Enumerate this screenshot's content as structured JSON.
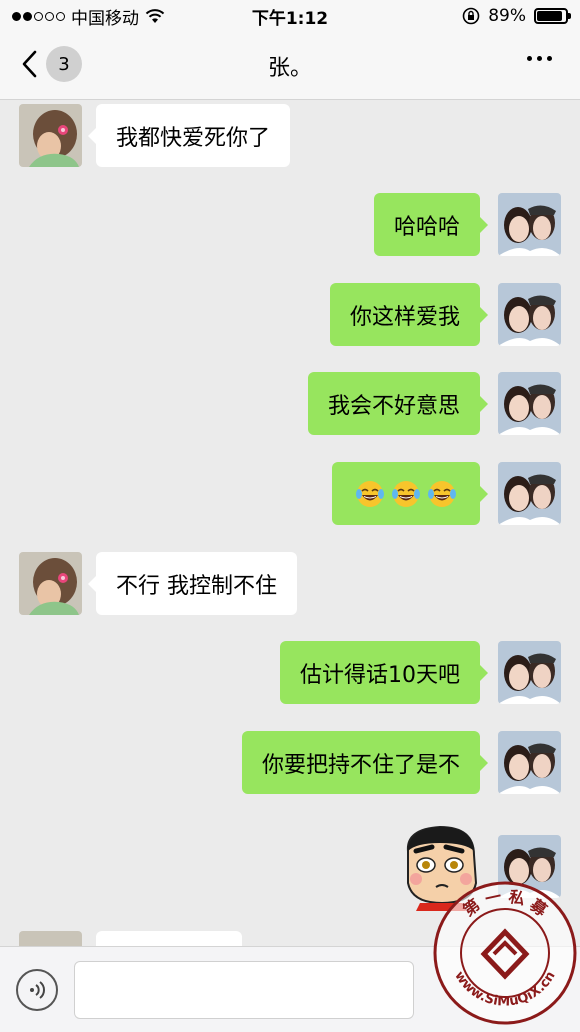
{
  "status_bar": {
    "carrier": "中国移动",
    "time": "下午1:12",
    "battery_percent": "89%",
    "battery_level": 0.89,
    "icons": [
      "signal-dots",
      "wifi-icon",
      "rotation-lock-icon",
      "battery-icon"
    ]
  },
  "nav": {
    "unread_count": "3",
    "title": "张。",
    "back_icon": "chevron-left-icon",
    "more_icon": "more-dots-icon"
  },
  "messages": [
    {
      "side": "left",
      "text": "我都快爱死你了"
    },
    {
      "side": "right",
      "text": "哈哈哈"
    },
    {
      "side": "right",
      "text": "你这样爱我"
    },
    {
      "side": "right",
      "text": "我会不好意思"
    },
    {
      "side": "right",
      "emoji": [
        "laughing-crying-emoji",
        "laughing-crying-emoji",
        "laughing-crying-emoji"
      ]
    },
    {
      "side": "left",
      "text": "不行 我控制不住"
    },
    {
      "side": "right",
      "text": "估计得话10天吧"
    },
    {
      "side": "right",
      "text": "你要把持不住了是不"
    },
    {
      "side": "right",
      "sticker": "crayon-shinchan-sticker"
    }
  ],
  "input": {
    "voice_icon": "voice-icon",
    "placeholder": ""
  },
  "watermark": {
    "text_top": "第 一 私 募",
    "text_bottom": "www.SiMuQiX.cn"
  },
  "colors": {
    "sent_bubble": "#97e55e",
    "received_bubble": "#ffffff",
    "background": "#ebebeb"
  }
}
